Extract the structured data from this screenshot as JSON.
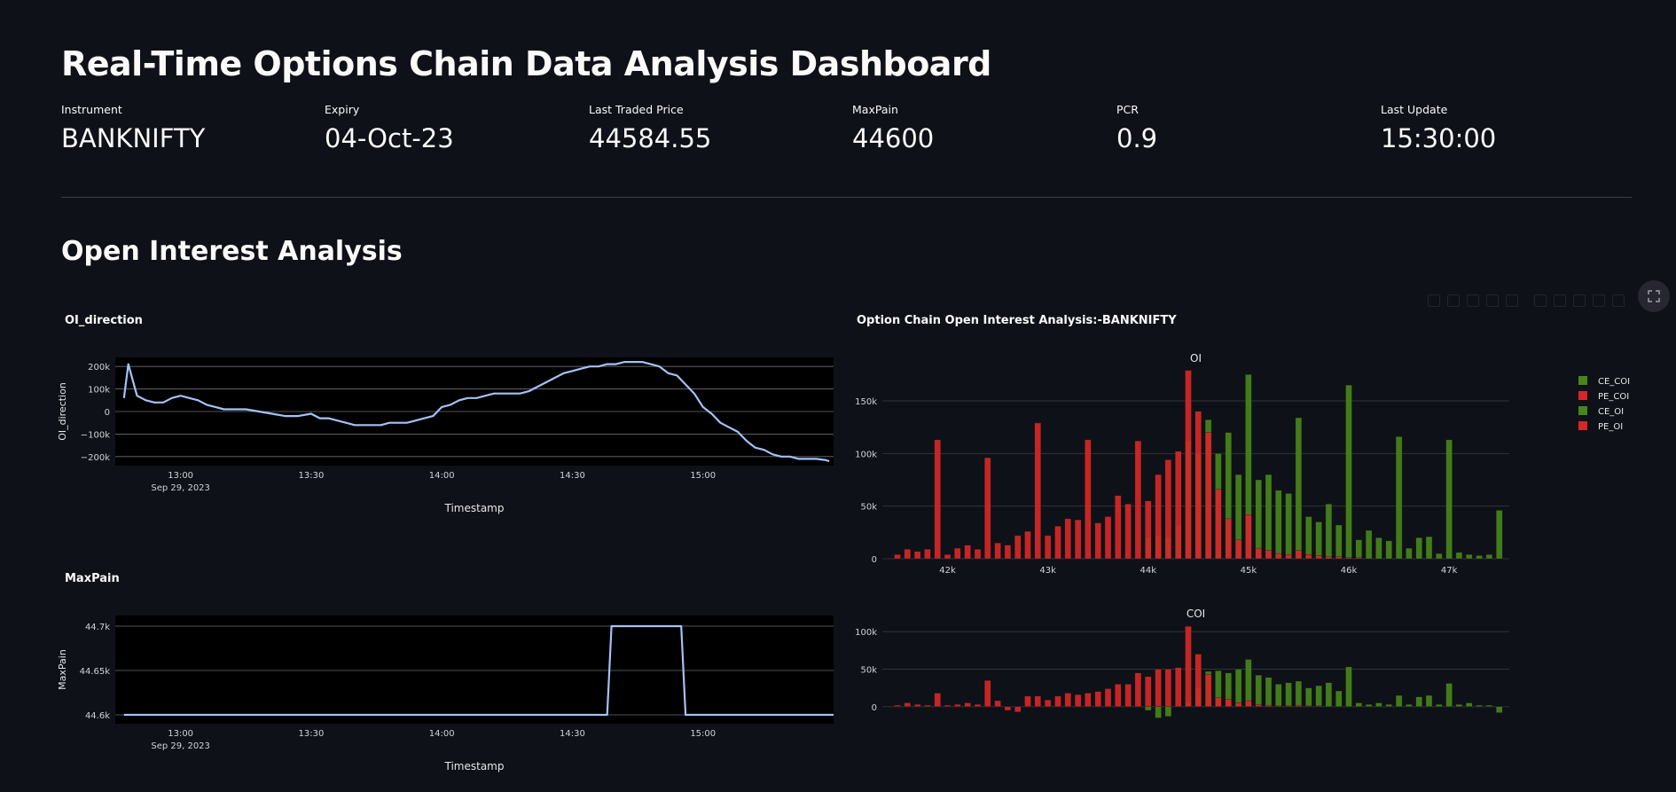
{
  "page": {
    "title": "Real-Time Options Chain Data Analysis Dashboard",
    "section_title": "Open Interest Analysis"
  },
  "metrics": [
    {
      "label": "Instrument",
      "value": "BANKNIFTY"
    },
    {
      "label": "Expiry",
      "value": "04-Oct-23"
    },
    {
      "label": "Last Traded Price",
      "value": "44584.55"
    },
    {
      "label": "MaxPain",
      "value": "44600"
    },
    {
      "label": "PCR",
      "value": "0.9"
    },
    {
      "label": "Last Update",
      "value": "15:30:00"
    }
  ],
  "toolbar": {
    "icons": [
      "camera-icon",
      "zoom-icon",
      "pan-icon",
      "box-select-icon",
      "lasso-icon",
      "zoom-in-icon",
      "zoom-out-icon",
      "autoscale-icon",
      "reset-axes-icon",
      "spike-lines-icon",
      "hover-icon"
    ],
    "expand_icon": "fullscreen-icon"
  },
  "colors": {
    "background": "#0e1117",
    "plot_bg": "#000000",
    "line": "#a4c2f4",
    "ce": "#46861b",
    "pe": "#d62728"
  },
  "chart_data": [
    {
      "id": "oi_direction",
      "type": "line",
      "title": "OI_direction",
      "xlabel": "Timestamp",
      "ylabel": "OI_direction",
      "x_ticks": [
        "13:00",
        "13:30",
        "14:00",
        "14:30",
        "15:00"
      ],
      "x_sublabel": "Sep 29, 2023",
      "x_range": [
        "12:45",
        "15:30"
      ],
      "y_ticks": [
        200000,
        100000,
        0,
        -100000,
        -200000
      ],
      "y_tick_labels": [
        "200k",
        "100k",
        "0",
        "−100k",
        "−200k"
      ],
      "ylim": [
        -240000,
        240000
      ],
      "grid": true,
      "series": [
        {
          "x": [
            "12:47",
            "12:48",
            "12:50",
            "12:52",
            "12:54",
            "12:56",
            "12:58",
            "13:00",
            "13:02",
            "13:04",
            "13:06",
            "13:08",
            "13:10",
            "13:12",
            "13:15",
            "13:18",
            "13:21",
            "13:24",
            "13:27",
            "13:30",
            "13:32",
            "13:34",
            "13:36",
            "13:38",
            "13:40",
            "13:42",
            "13:44",
            "13:46",
            "13:48",
            "13:50",
            "13:52",
            "13:54",
            "13:56",
            "13:58",
            "14:00",
            "14:02",
            "14:04",
            "14:06",
            "14:08",
            "14:10",
            "14:12",
            "14:14",
            "14:16",
            "14:18",
            "14:20",
            "14:22",
            "14:24",
            "14:26",
            "14:28",
            "14:30",
            "14:32",
            "14:34",
            "14:36",
            "14:38",
            "14:40",
            "14:42",
            "14:44",
            "14:46",
            "14:48",
            "14:50",
            "14:52",
            "14:54",
            "14:56",
            "14:58",
            "15:00",
            "15:02",
            "15:04",
            "15:06",
            "15:08",
            "15:10",
            "15:12",
            "15:14",
            "15:16",
            "15:18",
            "15:20",
            "15:22",
            "15:24",
            "15:26",
            "15:28",
            "15:29"
          ],
          "y": [
            60000,
            210000,
            70000,
            50000,
            40000,
            40000,
            60000,
            70000,
            60000,
            50000,
            30000,
            20000,
            10000,
            10000,
            10000,
            0,
            -10000,
            -20000,
            -20000,
            -10000,
            -30000,
            -30000,
            -40000,
            -50000,
            -60000,
            -60000,
            -60000,
            -60000,
            -50000,
            -50000,
            -50000,
            -40000,
            -30000,
            -20000,
            20000,
            30000,
            50000,
            60000,
            60000,
            70000,
            80000,
            80000,
            80000,
            80000,
            90000,
            110000,
            130000,
            150000,
            170000,
            180000,
            190000,
            200000,
            200000,
            210000,
            210000,
            220000,
            220000,
            220000,
            210000,
            200000,
            170000,
            160000,
            120000,
            80000,
            20000,
            -10000,
            -50000,
            -70000,
            -90000,
            -130000,
            -160000,
            -170000,
            -190000,
            -200000,
            -200000,
            -210000,
            -210000,
            -210000,
            -215000,
            -220000
          ]
        }
      ]
    },
    {
      "id": "maxpain",
      "type": "line",
      "title": "MaxPain",
      "xlabel": "Timestamp",
      "ylabel": "MaxPain",
      "x_ticks": [
        "13:00",
        "13:30",
        "14:00",
        "14:30",
        "15:00"
      ],
      "x_sublabel": "Sep 29, 2023",
      "x_range": [
        "12:45",
        "15:30"
      ],
      "y_ticks": [
        44700,
        44650,
        44600
      ],
      "y_tick_labels": [
        "44.7k",
        "44.65k",
        "44.6k"
      ],
      "ylim": [
        44590,
        44712
      ],
      "grid": true,
      "series": [
        {
          "x": [
            "12:47",
            "14:38",
            "14:39",
            "14:55",
            "14:56",
            "15:30"
          ],
          "y": [
            44600,
            44600,
            44700,
            44700,
            44600,
            44600
          ]
        }
      ]
    },
    {
      "id": "oi",
      "type": "bar",
      "title": "Option Chain Open Interest Analysis:-BANKNIFTY",
      "subplot_title": "OI",
      "x_ticks": [
        42000,
        43000,
        44000,
        45000,
        46000,
        47000
      ],
      "x_tick_labels": [
        "42k",
        "43k",
        "44k",
        "45k",
        "46k",
        "47k"
      ],
      "xlim": [
        41350,
        47600
      ],
      "y_ticks": [
        0,
        50000,
        100000,
        150000
      ],
      "y_tick_labels": [
        "0",
        "50k",
        "100k",
        "150k"
      ],
      "ylim": [
        0,
        182000
      ],
      "strikes": [
        41500,
        41600,
        41700,
        41800,
        41900,
        42000,
        42100,
        42200,
        42300,
        42400,
        42500,
        42600,
        42700,
        42800,
        42900,
        43000,
        43100,
        43200,
        43300,
        43400,
        43500,
        43600,
        43700,
        43800,
        43900,
        44000,
        44100,
        44200,
        44300,
        44400,
        44500,
        44600,
        44700,
        44800,
        44900,
        45000,
        45100,
        45200,
        45300,
        45400,
        45500,
        45600,
        45700,
        45800,
        45900,
        46000,
        46100,
        46200,
        46300,
        46400,
        46500,
        46600,
        46700,
        46800,
        46900,
        47000,
        47100,
        47200,
        47300,
        47400,
        47500
      ],
      "legend": [
        "CE_COI",
        "PE_COI",
        "CE_OI",
        "PE_OI"
      ],
      "legend_position": "top-right",
      "series": [
        {
          "name": "CE_OI",
          "values": [
            0,
            0,
            0,
            0,
            0,
            0,
            0,
            0,
            0,
            0,
            0,
            0,
            0,
            0,
            0,
            0,
            0,
            0,
            0,
            0,
            0,
            0,
            0,
            0,
            0,
            20000,
            22000,
            20000,
            32000,
            112000,
            100000,
            132000,
            100000,
            120000,
            80000,
            175000,
            75000,
            80000,
            65000,
            62000,
            134000,
            40000,
            35000,
            52000,
            32000,
            165000,
            18000,
            27000,
            20000,
            17000,
            116000,
            10000,
            20000,
            21000,
            5000,
            113000,
            6000,
            4000,
            3000,
            4000,
            46000
          ]
        },
        {
          "name": "PE_OI",
          "values": [
            4000,
            9000,
            7000,
            9000,
            113000,
            4000,
            10000,
            13000,
            9000,
            96000,
            15000,
            13000,
            22000,
            26000,
            129000,
            22000,
            31000,
            38000,
            37000,
            113000,
            34000,
            40000,
            60000,
            52000,
            112000,
            55000,
            80000,
            94000,
            102000,
            179000,
            140000,
            120000,
            66000,
            38000,
            18000,
            42000,
            10000,
            8000,
            5000,
            4000,
            8000,
            4000,
            3000,
            2000,
            2000,
            1000,
            1000,
            0,
            0,
            0,
            0,
            0,
            0,
            0,
            0,
            0,
            0,
            0,
            0,
            0,
            0
          ]
        }
      ]
    },
    {
      "id": "coi",
      "type": "bar",
      "subplot_title": "COI",
      "x_ticks": [
        42000,
        43000,
        44000,
        45000,
        46000,
        47000
      ],
      "x_tick_labels": [
        "42k",
        "43k",
        "44k",
        "45k",
        "46k",
        "47k"
      ],
      "xlim": [
        41350,
        47600
      ],
      "y_ticks": [
        0,
        50000,
        100000
      ],
      "y_tick_labels": [
        "0",
        "50k",
        "100k"
      ],
      "ylim": [
        -18000,
        112000
      ],
      "strikes": [
        41500,
        41600,
        41700,
        41800,
        41900,
        42000,
        42100,
        42200,
        42300,
        42400,
        42500,
        42600,
        42700,
        42800,
        42900,
        43000,
        43100,
        43200,
        43300,
        43400,
        43500,
        43600,
        43700,
        43800,
        43900,
        44000,
        44100,
        44200,
        44300,
        44400,
        44500,
        44600,
        44700,
        44800,
        44900,
        45000,
        45100,
        45200,
        45300,
        45400,
        45500,
        45600,
        45700,
        45800,
        45900,
        46000,
        46100,
        46200,
        46300,
        46400,
        46500,
        46600,
        46700,
        46800,
        46900,
        47000,
        47100,
        47200,
        47300,
        47400,
        47500
      ],
      "series": [
        {
          "name": "CE_COI",
          "values": [
            0,
            0,
            0,
            0,
            0,
            0,
            0,
            0,
            0,
            0,
            0,
            0,
            0,
            0,
            0,
            0,
            0,
            0,
            0,
            0,
            0,
            0,
            0,
            0,
            0,
            -5000,
            -15000,
            -13000,
            0,
            5000,
            25000,
            47000,
            48000,
            45000,
            50000,
            63000,
            42000,
            39000,
            30000,
            32000,
            34000,
            25000,
            28000,
            32000,
            21000,
            53000,
            5000,
            3000,
            5000,
            3000,
            15000,
            3000,
            13000,
            15000,
            3000,
            31000,
            3000,
            5000,
            2000,
            2000,
            -8000
          ]
        },
        {
          "name": "PE_COI",
          "values": [
            2000,
            5000,
            3000,
            2000,
            18000,
            2000,
            3000,
            5000,
            3000,
            35000,
            8000,
            -5000,
            -7000,
            14000,
            14000,
            9000,
            14000,
            18000,
            16000,
            18000,
            20000,
            24000,
            30000,
            30000,
            45000,
            40000,
            50000,
            50000,
            52000,
            107000,
            70000,
            43000,
            12000,
            10000,
            5000,
            8000,
            3000,
            2000,
            1000,
            1000,
            2000,
            1000,
            1000,
            0,
            0,
            0,
            0,
            0,
            0,
            0,
            0,
            0,
            0,
            0,
            0,
            0,
            0,
            0,
            0,
            0,
            0
          ]
        }
      ]
    }
  ]
}
